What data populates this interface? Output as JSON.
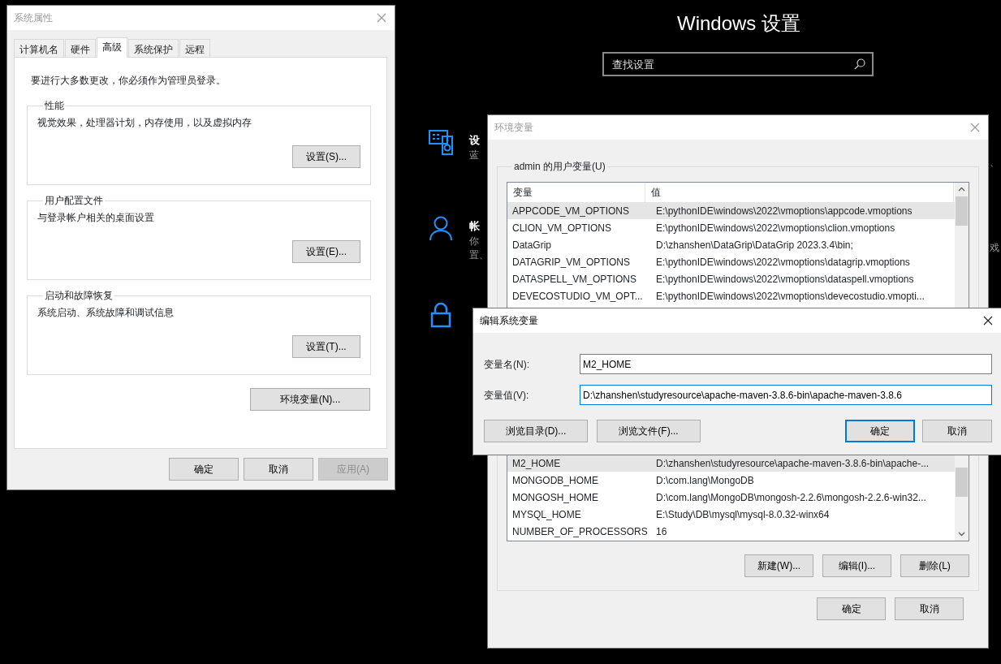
{
  "settings": {
    "title": "Windows 设置",
    "search": {
      "placeholder": "查找设置"
    },
    "categories": [
      {
        "lines": [
          "设",
          "蓝"
        ]
      },
      {
        "lines": [
          "帐",
          "你",
          "置、"
        ]
      }
    ],
    "right_fragments": [
      "、",
      "戏"
    ]
  },
  "system_properties": {
    "title": "系统属性",
    "tabs": [
      {
        "label": "计算机名",
        "selected": false
      },
      {
        "label": "硬件",
        "selected": false
      },
      {
        "label": "高级",
        "selected": true
      },
      {
        "label": "系统保护",
        "selected": false
      },
      {
        "label": "远程",
        "selected": false
      }
    ],
    "notice": "要进行大多数更改，你必须作为管理员登录。",
    "groups": [
      {
        "title": "性能",
        "description": "视觉效果，处理器计划，内存使用，以及虚拟内存",
        "button": "设置(S)..."
      },
      {
        "title": "用户配置文件",
        "description": "与登录帐户相关的桌面设置",
        "button": "设置(E)..."
      },
      {
        "title": "启动和故障恢复",
        "description": "系统启动、系统故障和调试信息",
        "button": "设置(T)..."
      }
    ],
    "env_button": "环境变量(N)...",
    "buttons": [
      {
        "label": "确定",
        "disabled": false
      },
      {
        "label": "取消",
        "disabled": false
      },
      {
        "label": "应用(A)",
        "disabled": true
      }
    ]
  },
  "environment_variables": {
    "title": "环境变量",
    "user_group": "admin 的用户变量(U)",
    "user_table": {
      "columns": [
        "变量",
        "值"
      ],
      "rows": [
        {
          "name": "APPCODE_VM_OPTIONS",
          "value": "E:\\pythonIDE\\windows\\2022\\vmoptions\\appcode.vmoptions",
          "selected": true
        },
        {
          "name": "CLION_VM_OPTIONS",
          "value": "E:\\pythonIDE\\windows\\2022\\vmoptions\\clion.vmoptions",
          "selected": false
        },
        {
          "name": "DataGrip",
          "value": "D:\\zhanshen\\DataGrip\\DataGrip 2023.3.4\\bin;",
          "selected": false
        },
        {
          "name": "DATAGRIP_VM_OPTIONS",
          "value": "E:\\pythonIDE\\windows\\2022\\vmoptions\\datagrip.vmoptions",
          "selected": false
        },
        {
          "name": "DATASPELL_VM_OPTIONS",
          "value": "E:\\pythonIDE\\windows\\2022\\vmoptions\\dataspell.vmoptions",
          "selected": false
        },
        {
          "name": "DEVECOSTUDIO_VM_OPT...",
          "value": "E:\\pythonIDE\\windows\\2022\\vmoptions\\devecostudio.vmopti...",
          "selected": false
        }
      ]
    },
    "system_table": {
      "rows": [
        {
          "name": "M2_HOME",
          "value": "D:\\zhanshen\\studyresource\\apache-maven-3.8.6-bin\\apache-...",
          "selected": true
        },
        {
          "name": "MONGODB_HOME",
          "value": "D:\\com.lang\\MongoDB",
          "selected": false
        },
        {
          "name": "MONGOSH_HOME",
          "value": "D:\\com.lang\\MongoDB\\mongosh-2.2.6\\mongosh-2.2.6-win32...",
          "selected": false
        },
        {
          "name": "MYSQL_HOME",
          "value": "E:\\Study\\DB\\mysql\\mysql-8.0.32-winx64",
          "selected": false
        },
        {
          "name": "NUMBER_OF_PROCESSORS",
          "value": "16",
          "selected": false
        }
      ]
    },
    "system_buttons": [
      "新建(W)...",
      "编辑(I)...",
      "删除(L)"
    ],
    "buttons": [
      "确定",
      "取消"
    ]
  },
  "edit_dialog": {
    "title": "编辑系统变量",
    "fields": [
      {
        "label": "变量名(N):",
        "value": "M2_HOME",
        "focused": false
      },
      {
        "label": "变量值(V):",
        "value": "D:\\zhanshen\\studyresource\\apache-maven-3.8.6-bin\\apache-maven-3.8.6",
        "focused": true
      }
    ],
    "buttons": [
      {
        "label": "浏览目录(D)...",
        "default": false
      },
      {
        "label": "浏览文件(F)...",
        "default": false
      },
      {
        "label": "确定",
        "default": true
      },
      {
        "label": "取消",
        "default": false
      }
    ]
  }
}
